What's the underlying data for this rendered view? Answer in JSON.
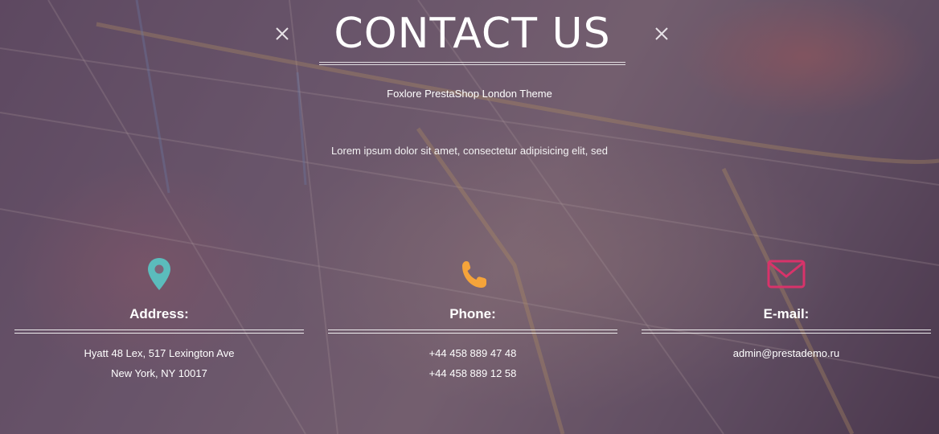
{
  "header": {
    "title": "CONTACT US"
  },
  "subtitle": "Foxlore PrestaShop London Theme",
  "lead": "Lorem ipsum dolor sit amet, consectetur adipisicing elit, sed",
  "contacts": [
    {
      "icon": "map-pin-icon",
      "icon_color": "#5bbcbc",
      "heading": "Address:",
      "lines": [
        "Hyatt 48 Lex, 517 Lexington Ave",
        "New York, NY 10017"
      ]
    },
    {
      "icon": "phone-icon",
      "icon_color": "#f5a43a",
      "heading": "Phone:",
      "lines": [
        "+44 458 889 47 48",
        "+44 458 889 12 58"
      ]
    },
    {
      "icon": "envelope-icon",
      "icon_color": "#d8336a",
      "heading": "E-mail:",
      "lines": [
        "admin@prestademo.ru"
      ]
    }
  ]
}
